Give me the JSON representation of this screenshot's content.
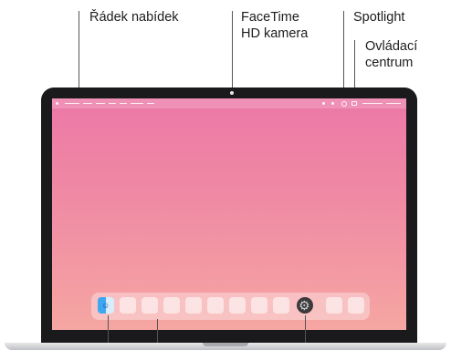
{
  "callouts": {
    "menubar": "Řádek nabídek",
    "camera_line1": "FaceTime",
    "camera_line2": "HD kamera",
    "spotlight": "Spotlight",
    "control_line1": "Ovládací",
    "control_line2": "centrum"
  },
  "colors": {
    "wallpaper_top": "#ec78a6",
    "wallpaper_bottom": "#f5a6a2",
    "bezel": "#1a1a1c"
  },
  "icons": {
    "finder": "finder-icon",
    "settings": "system-settings-icon"
  }
}
